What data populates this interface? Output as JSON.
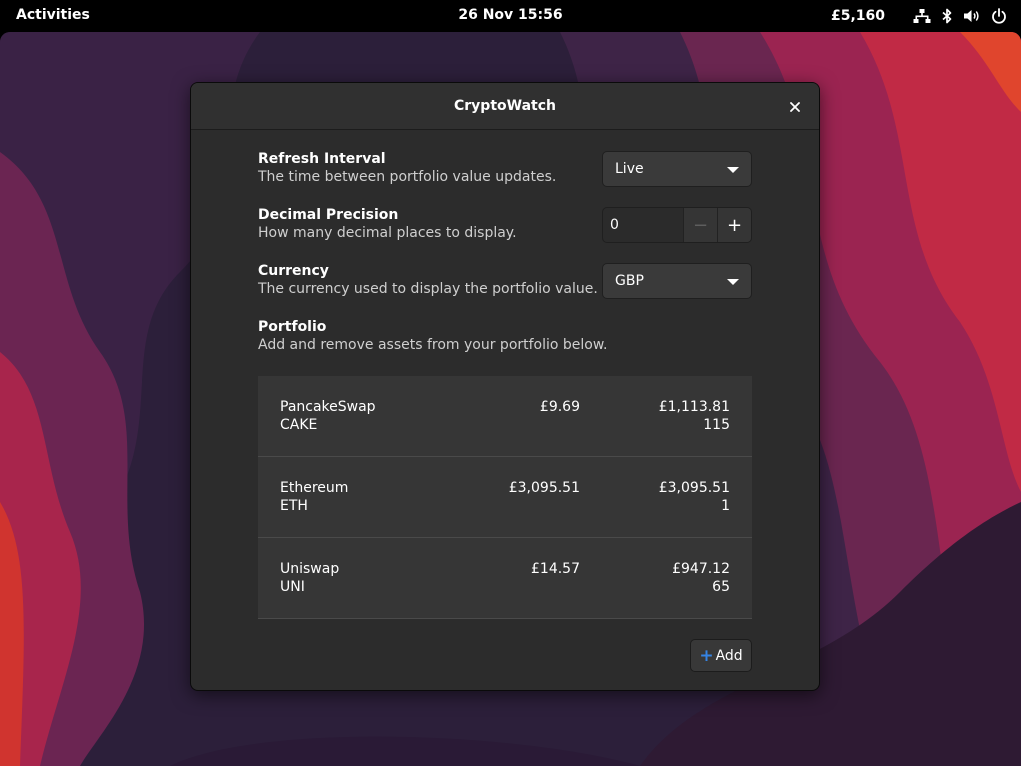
{
  "topbar": {
    "activities": "Activities",
    "clock": "26 Nov  15:56",
    "indicator": "£5,160",
    "icons": [
      "network-icon",
      "bluetooth-icon",
      "volume-icon",
      "power-icon"
    ]
  },
  "window": {
    "title": "CryptoWatch",
    "close_icon": "close-icon"
  },
  "settings": {
    "refresh": {
      "title": "Refresh Interval",
      "subtitle": "The time between portfolio value updates.",
      "value": "Live"
    },
    "precision": {
      "title": "Decimal Precision",
      "subtitle": "How many decimal places to display.",
      "value": "0",
      "minus": "−",
      "plus": "+"
    },
    "currency": {
      "title": "Currency",
      "subtitle": "The currency used to display the portfolio value.",
      "value": "GBP"
    },
    "portfolio": {
      "title": "Portfolio",
      "subtitle": "Add and remove assets from your portfolio below."
    }
  },
  "assets": [
    {
      "name": "PancakeSwap",
      "symbol": "CAKE",
      "price": "£9.69",
      "value": "£1,113.81",
      "amount": "115"
    },
    {
      "name": "Ethereum",
      "symbol": "ETH",
      "price": "£3,095.51",
      "value": "£3,095.51",
      "amount": "1"
    },
    {
      "name": "Uniswap",
      "symbol": "UNI",
      "price": "£14.57",
      "value": "£947.12",
      "amount": "65"
    }
  ],
  "add_button": {
    "label": "Add",
    "icon": "plus-icon"
  },
  "colors": {
    "accent": "#3584e4",
    "window_bg": "#2c2c2c",
    "list_bg": "#363636"
  }
}
